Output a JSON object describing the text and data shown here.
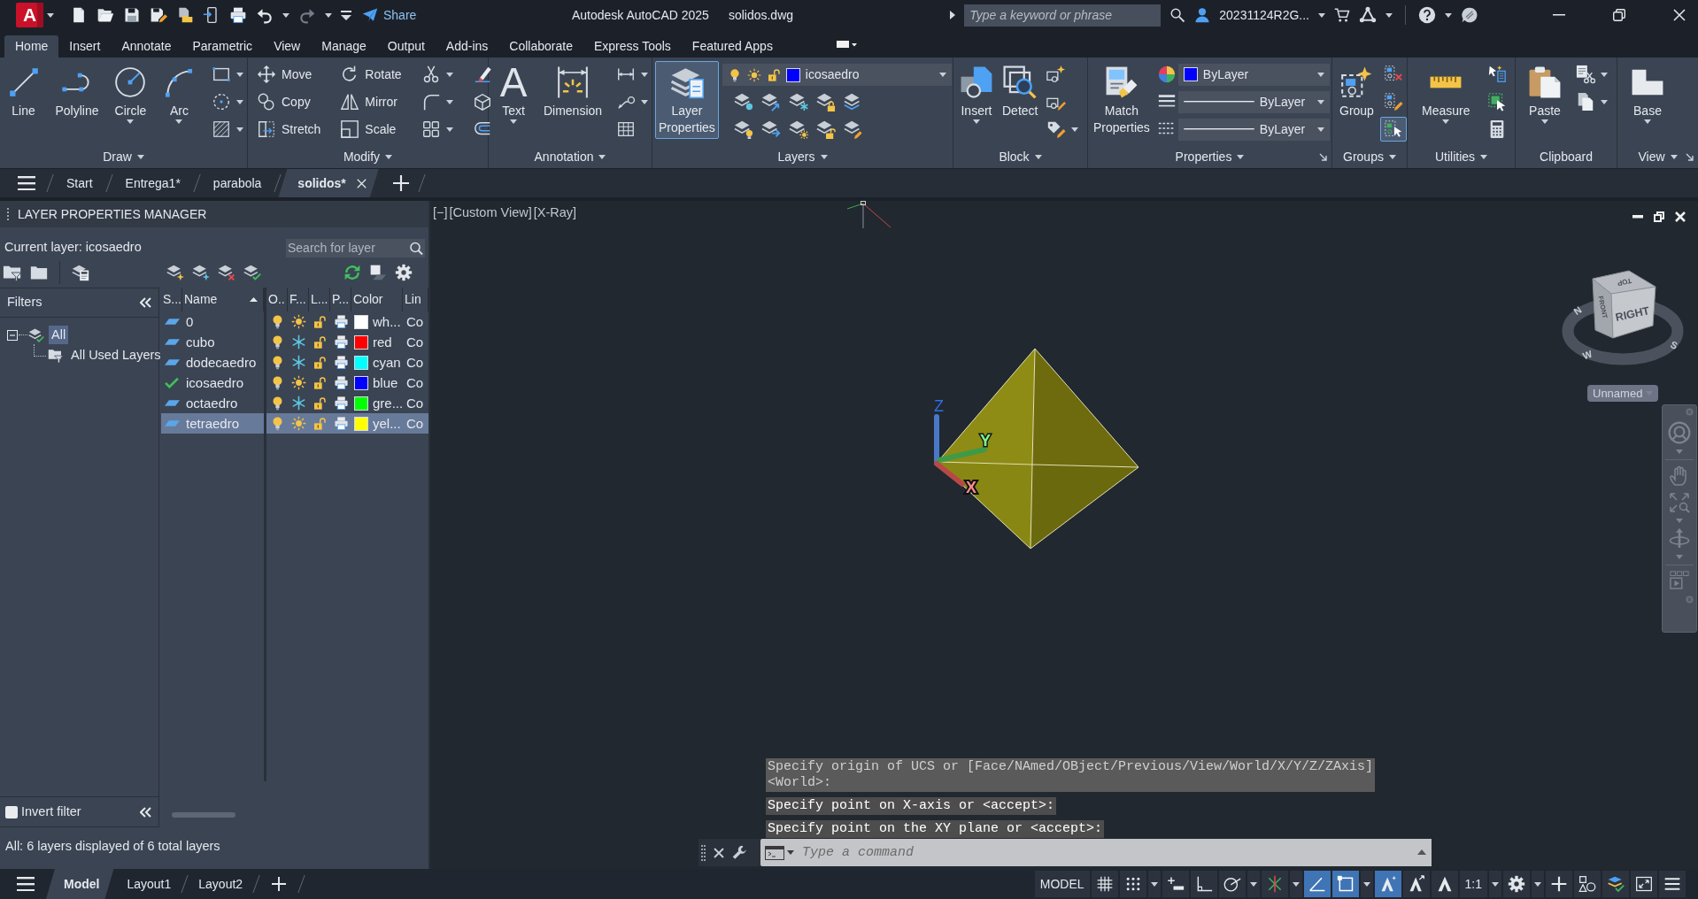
{
  "title_bar": {
    "logo_letter": "A",
    "share_label": "Share",
    "app_title": "Autodesk AutoCAD 2025",
    "file_name": "solidos.dwg",
    "search": {
      "placeholder": "Type a keyword or phrase"
    },
    "user_name": "20231124R2G..."
  },
  "ribbon_tabs": [
    {
      "label": "Home",
      "selected": true
    },
    {
      "label": "Insert",
      "selected": false
    },
    {
      "label": "Annotate",
      "selected": false
    },
    {
      "label": "Parametric",
      "selected": false
    },
    {
      "label": "View",
      "selected": false
    },
    {
      "label": "Manage",
      "selected": false
    },
    {
      "label": "Output",
      "selected": false
    },
    {
      "label": "Add-ins",
      "selected": false
    },
    {
      "label": "Collaborate",
      "selected": false
    },
    {
      "label": "Express Tools",
      "selected": false
    },
    {
      "label": "Featured Apps",
      "selected": false
    }
  ],
  "ribbon_panels": [
    {
      "title": "Draw",
      "menu": true,
      "launcher": false,
      "tools": [
        {
          "kind": "large",
          "label": "Line",
          "caret": false,
          "active": false
        },
        {
          "kind": "large",
          "label": "Polyline",
          "caret": false,
          "active": false
        },
        {
          "kind": "large",
          "label": "Circle",
          "caret": true,
          "active": false
        },
        {
          "kind": "large",
          "label": "Arc",
          "caret": true,
          "active": false
        },
        {
          "kind": "small",
          "caret": true,
          "active": false
        },
        {
          "kind": "small",
          "caret": true,
          "active": false
        },
        {
          "kind": "small",
          "caret": true,
          "active": false
        }
      ]
    },
    {
      "title": "Modify",
      "menu": true,
      "launcher": false,
      "tools": [
        {
          "kind": "small",
          "label": "Move",
          "caret": false,
          "active": false
        },
        {
          "kind": "small",
          "label": "Copy",
          "caret": false,
          "active": false
        },
        {
          "kind": "small",
          "label": "Stretch",
          "caret": false,
          "active": false
        },
        {
          "kind": "small",
          "label": "Rotate",
          "caret": false,
          "active": false
        },
        {
          "kind": "small",
          "label": "Mirror",
          "caret": false,
          "active": false
        },
        {
          "kind": "small",
          "label": "Scale",
          "caret": false,
          "active": false
        },
        {
          "kind": "small",
          "caret": true,
          "active": false
        },
        {
          "kind": "small",
          "caret": true,
          "active": false
        },
        {
          "kind": "small",
          "caret": true,
          "active": false
        },
        {
          "kind": "small",
          "caret": false,
          "active": false
        },
        {
          "kind": "small",
          "caret": false,
          "active": false
        },
        {
          "kind": "small",
          "caret": false,
          "active": false
        }
      ]
    },
    {
      "title": "Annotation",
      "menu": true,
      "launcher": false,
      "tools": [
        {
          "kind": "large",
          "glyph": "A",
          "label": "Text",
          "caret": true,
          "active": false
        },
        {
          "kind": "large",
          "label": "Dimension",
          "caret": false,
          "active": false
        },
        {
          "kind": "small",
          "caret": true,
          "active": false
        },
        {
          "kind": "small",
          "caret": true,
          "active": false
        },
        {
          "kind": "small",
          "caret": false,
          "active": false
        }
      ]
    },
    {
      "title": "Layers",
      "menu": true,
      "launcher": false,
      "tools": [
        {
          "kind": "large",
          "label": "Layer Properties",
          "caret": false,
          "active": true
        },
        {
          "kind": "layer_dropdown",
          "value": "icosaedro",
          "color": "#0000ff"
        },
        {
          "kind": "small",
          "caret": false,
          "active": false
        },
        {
          "kind": "small",
          "caret": false,
          "active": false
        },
        {
          "kind": "small",
          "caret": false,
          "active": false
        },
        {
          "kind": "small",
          "caret": false,
          "active": false
        },
        {
          "kind": "small",
          "caret": false,
          "active": false
        },
        {
          "kind": "small",
          "caret": false,
          "active": false
        },
        {
          "kind": "small",
          "caret": false,
          "active": false
        },
        {
          "kind": "small",
          "caret": false,
          "active": false
        },
        {
          "kind": "small",
          "caret": false,
          "active": false
        },
        {
          "kind": "small",
          "caret": false,
          "active": false
        }
      ]
    },
    {
      "title": "Block",
      "menu": true,
      "launcher": false,
      "tools": [
        {
          "kind": "large",
          "label": "Insert",
          "caret": true,
          "active": false
        },
        {
          "kind": "large",
          "label": "Detect",
          "caret": false,
          "active": false
        },
        {
          "kind": "small",
          "caret": false,
          "active": false
        },
        {
          "kind": "small",
          "caret": false,
          "active": false
        },
        {
          "kind": "small",
          "caret": true,
          "active": false
        }
      ]
    },
    {
      "title": "Properties",
      "menu": true,
      "launcher": true,
      "tools": [
        {
          "kind": "large",
          "label": "Match Properties",
          "caret": false,
          "active": false
        },
        {
          "kind": "color_dropdown",
          "value": "ByLayer",
          "color": "#0000ff"
        },
        {
          "kind": "line_dropdown",
          "value": "ByLayer"
        },
        {
          "kind": "line_dropdown",
          "value": "ByLayer"
        }
      ]
    },
    {
      "title": "Groups",
      "menu": true,
      "launcher": false,
      "tools": [
        {
          "kind": "large",
          "label": "Group",
          "caret": false,
          "active": false
        },
        {
          "kind": "small",
          "caret": false,
          "active": false
        },
        {
          "kind": "small",
          "caret": false,
          "active": false
        },
        {
          "kind": "small",
          "caret": false,
          "active": true
        }
      ]
    },
    {
      "title": "Utilities",
      "menu": true,
      "launcher": false,
      "tools": [
        {
          "kind": "large",
          "label": "Measure",
          "caret": true,
          "active": false
        },
        {
          "kind": "small",
          "caret": false,
          "active": false
        },
        {
          "kind": "small",
          "caret": false,
          "active": false
        },
        {
          "kind": "small",
          "caret": false,
          "active": false
        }
      ]
    },
    {
      "title": "Clipboard",
      "menu": false,
      "launcher": false,
      "tools": [
        {
          "kind": "large",
          "label": "Paste",
          "caret": true,
          "active": false
        },
        {
          "kind": "small",
          "caret": true,
          "active": false
        },
        {
          "kind": "small",
          "caret": true,
          "active": false
        }
      ]
    },
    {
      "title": "View",
      "menu": true,
      "launcher": true,
      "tools": [
        {
          "kind": "large",
          "label": "Base",
          "caret": true,
          "active": false
        }
      ]
    }
  ],
  "file_tabs": [
    {
      "label": "Start",
      "selected": false
    },
    {
      "label": "Entrega1*",
      "selected": false
    },
    {
      "label": "parabola",
      "selected": false
    },
    {
      "label": "solidos*",
      "selected": true
    }
  ],
  "layer_manager": {
    "title": "LAYER PROPERTIES MANAGER",
    "current_layer": "Current layer: icosaedro",
    "search": {
      "placeholder": "Search for layer"
    },
    "filters": {
      "title": "Filters",
      "tree": [
        {
          "label": "All",
          "selected": true,
          "expanded": true,
          "children": [
            {
              "label": "All Used Layers",
              "selected": false
            }
          ]
        }
      ],
      "invert_filter": {
        "label": "Invert filter",
        "checked": false
      }
    },
    "columns": [
      {
        "label": "S...",
        "sorted": false
      },
      {
        "label": "Name",
        "sorted": true
      },
      {
        "label": "O..",
        "sorted": false
      },
      {
        "label": "F...",
        "sorted": false
      },
      {
        "label": "L...",
        "sorted": false
      },
      {
        "label": "P...",
        "sorted": false
      },
      {
        "label": "Color",
        "sorted": false
      },
      {
        "label": "Lin",
        "sorted": false
      }
    ],
    "layers": [
      {
        "name": "0",
        "current": false,
        "on": true,
        "frozen": false,
        "locked": false,
        "plot": true,
        "color": "#ffffff",
        "color_name": "wh...",
        "linetype": "Co",
        "selected": false
      },
      {
        "name": "cubo",
        "current": false,
        "on": true,
        "frozen": true,
        "locked": false,
        "plot": true,
        "color": "#ff0000",
        "color_name": "red",
        "linetype": "Co",
        "selected": false
      },
      {
        "name": "dodecaedro",
        "current": false,
        "on": true,
        "frozen": true,
        "locked": false,
        "plot": true,
        "color": "#00ffff",
        "color_name": "cyan",
        "linetype": "Co",
        "selected": false
      },
      {
        "name": "icosaedro",
        "current": true,
        "on": true,
        "frozen": false,
        "locked": false,
        "plot": true,
        "color": "#0000ff",
        "color_name": "blue",
        "linetype": "Co",
        "selected": false
      },
      {
        "name": "octaedro",
        "current": false,
        "on": true,
        "frozen": true,
        "locked": false,
        "plot": true,
        "color": "#00ff00",
        "color_name": "gre...",
        "linetype": "Co",
        "selected": false
      },
      {
        "name": "tetraedro",
        "current": false,
        "on": true,
        "frozen": false,
        "locked": false,
        "plot": true,
        "color": "#ffff00",
        "color_name": "yel...",
        "linetype": "Co",
        "selected": true
      }
    ],
    "status": "All: 6 layers displayed of 6 total layers"
  },
  "viewport": {
    "controls": [
      "[−]",
      "[Custom View]",
      "[X-Ray]"
    ],
    "ucs_axis_labels": [
      "Z",
      "Y",
      "X"
    ],
    "view_cube": {
      "top": "TOP",
      "front": "FRONT",
      "right": "RIGHT",
      "compass": [
        "N",
        "W",
        "S"
      ]
    },
    "view_name": "Unnamed"
  },
  "command_line": {
    "history": [
      {
        "text": "Specify origin of UCS or [Face/NAmed/OBject/Previous/View/World/X/Y/Z/ZAxis]\n<World>:",
        "faded": true
      },
      {
        "text": "Specify point on X-axis or <accept>:",
        "faded": false
      },
      {
        "text": "Specify point on the XY plane or <accept>:",
        "faded": false
      }
    ],
    "placeholder": "Type a command"
  },
  "layout_tabs": [
    {
      "label": "Model",
      "selected": true
    },
    {
      "label": "Layout1",
      "selected": false
    },
    {
      "label": "Layout2",
      "selected": false
    }
  ],
  "status_bar": {
    "items": [
      {
        "kind": "label",
        "label": "MODEL",
        "caret": false
      },
      {
        "kind": "toggle",
        "active": false,
        "caret": false
      },
      {
        "kind": "toggle",
        "active": false,
        "caret": true
      },
      {
        "kind": "toggle",
        "active": false,
        "caret": false
      },
      {
        "kind": "toggle",
        "active": false,
        "caret": false
      },
      {
        "kind": "toggle",
        "active": false,
        "caret": true
      },
      {
        "kind": "toggle",
        "active": false,
        "caret": true
      },
      {
        "kind": "toggle",
        "active": true,
        "caret": false
      },
      {
        "kind": "toggle",
        "active": true,
        "caret": true
      },
      {
        "kind": "toggle",
        "active": true,
        "caret": false
      },
      {
        "kind": "toggle",
        "active": false,
        "caret": false
      },
      {
        "kind": "toggle",
        "active": false,
        "caret": false
      },
      {
        "kind": "label",
        "label": "1:1",
        "caret": true
      },
      {
        "kind": "toggle",
        "active": false,
        "caret": true
      },
      {
        "kind": "toggle",
        "active": false,
        "caret": false
      },
      {
        "kind": "toggle",
        "active": false,
        "caret": false
      },
      {
        "kind": "toggle",
        "active": false,
        "caret": false
      },
      {
        "kind": "toggle",
        "active": false,
        "caret": false
      },
      {
        "kind": "toggle",
        "active": false,
        "caret": false
      }
    ]
  }
}
